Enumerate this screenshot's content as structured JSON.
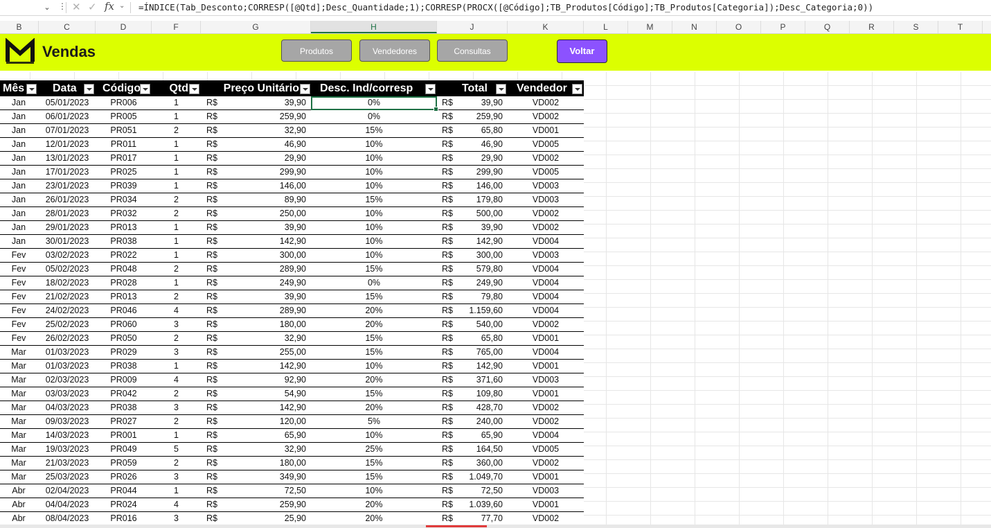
{
  "formula_bar": {
    "formula": "=ÍNDICE(Tab_Desconto;CORRESP([@Qtd];Desc_Quantidade;1);CORRESP(PROCX([@Código];TB_Produtos[Código];TB_Produtos[Categoria]);Desc_Categoria;0))",
    "fx_label": "fx"
  },
  "columns": [
    "B",
    "C",
    "D",
    "F",
    "G",
    "H",
    "J",
    "K",
    "L",
    "M",
    "N",
    "O",
    "P",
    "Q",
    "R",
    "S",
    "T"
  ],
  "banner": {
    "title": "Vendas",
    "buttons": [
      "Produtos",
      "Vendedores",
      "Consultas"
    ],
    "back": "Voltar",
    "colors": {
      "banner_bg": "#dcff00",
      "voltar_bg": "#8c52ff",
      "nav_bg": "#a6a6a6"
    }
  },
  "table": {
    "headers": [
      "Mês",
      "Data",
      "Código",
      "Qtd",
      "Preço Unitário",
      "Desc. Ind/corresp",
      "Total",
      "Vendedor"
    ],
    "currency": "R$",
    "rows": [
      [
        "Jan",
        "05/01/2023",
        "PR006",
        "1",
        "39,90",
        "0%",
        "39,90",
        "VD002"
      ],
      [
        "Jan",
        "06/01/2023",
        "PR005",
        "1",
        "259,90",
        "0%",
        "259,90",
        "VD002"
      ],
      [
        "Jan",
        "07/01/2023",
        "PR051",
        "2",
        "32,90",
        "15%",
        "65,80",
        "VD001"
      ],
      [
        "Jan",
        "12/01/2023",
        "PR011",
        "1",
        "46,90",
        "10%",
        "46,90",
        "VD005"
      ],
      [
        "Jan",
        "13/01/2023",
        "PR017",
        "1",
        "29,90",
        "10%",
        "29,90",
        "VD002"
      ],
      [
        "Jan",
        "17/01/2023",
        "PR025",
        "1",
        "299,90",
        "10%",
        "299,90",
        "VD005"
      ],
      [
        "Jan",
        "23/01/2023",
        "PR039",
        "1",
        "146,00",
        "10%",
        "146,00",
        "VD003"
      ],
      [
        "Jan",
        "26/01/2023",
        "PR034",
        "2",
        "89,90",
        "15%",
        "179,80",
        "VD003"
      ],
      [
        "Jan",
        "28/01/2023",
        "PR032",
        "2",
        "250,00",
        "10%",
        "500,00",
        "VD002"
      ],
      [
        "Jan",
        "29/01/2023",
        "PR013",
        "1",
        "39,90",
        "10%",
        "39,90",
        "VD002"
      ],
      [
        "Jan",
        "30/01/2023",
        "PR038",
        "1",
        "142,90",
        "10%",
        "142,90",
        "VD004"
      ],
      [
        "Fev",
        "03/02/2023",
        "PR022",
        "1",
        "300,00",
        "10%",
        "300,00",
        "VD003"
      ],
      [
        "Fev",
        "05/02/2023",
        "PR048",
        "2",
        "289,90",
        "15%",
        "579,80",
        "VD004"
      ],
      [
        "Fev",
        "18/02/2023",
        "PR028",
        "1",
        "249,90",
        "0%",
        "249,90",
        "VD004"
      ],
      [
        "Fev",
        "21/02/2023",
        "PR013",
        "2",
        "39,90",
        "15%",
        "79,80",
        "VD004"
      ],
      [
        "Fev",
        "24/02/2023",
        "PR046",
        "4",
        "289,90",
        "20%",
        "1.159,60",
        "VD004"
      ],
      [
        "Fev",
        "25/02/2023",
        "PR060",
        "3",
        "180,00",
        "20%",
        "540,00",
        "VD002"
      ],
      [
        "Fev",
        "26/02/2023",
        "PR050",
        "2",
        "32,90",
        "15%",
        "65,80",
        "VD001"
      ],
      [
        "Mar",
        "01/03/2023",
        "PR029",
        "3",
        "255,00",
        "15%",
        "765,00",
        "VD004"
      ],
      [
        "Mar",
        "01/03/2023",
        "PR038",
        "1",
        "142,90",
        "10%",
        "142,90",
        "VD001"
      ],
      [
        "Mar",
        "02/03/2023",
        "PR009",
        "4",
        "92,90",
        "20%",
        "371,60",
        "VD003"
      ],
      [
        "Mar",
        "03/03/2023",
        "PR042",
        "2",
        "54,90",
        "15%",
        "109,80",
        "VD001"
      ],
      [
        "Mar",
        "04/03/2023",
        "PR038",
        "3",
        "142,90",
        "20%",
        "428,70",
        "VD002"
      ],
      [
        "Mar",
        "09/03/2023",
        "PR027",
        "2",
        "120,00",
        "5%",
        "240,00",
        "VD002"
      ],
      [
        "Mar",
        "14/03/2023",
        "PR001",
        "1",
        "65,90",
        "10%",
        "65,90",
        "VD004"
      ],
      [
        "Mar",
        "19/03/2023",
        "PR049",
        "5",
        "32,90",
        "25%",
        "164,50",
        "VD005"
      ],
      [
        "Mar",
        "21/03/2023",
        "PR059",
        "2",
        "180,00",
        "15%",
        "360,00",
        "VD002"
      ],
      [
        "Mar",
        "25/03/2023",
        "PR026",
        "3",
        "349,90",
        "15%",
        "1.049,70",
        "VD001"
      ],
      [
        "Abr",
        "02/04/2023",
        "PR044",
        "1",
        "72,50",
        "10%",
        "72,50",
        "VD003"
      ],
      [
        "Abr",
        "04/04/2023",
        "PR024",
        "4",
        "259,90",
        "20%",
        "1.039,60",
        "VD001"
      ],
      [
        "Abr",
        "08/04/2023",
        "PR016",
        "3",
        "25,90",
        "20%",
        "77,70",
        "VD002"
      ]
    ]
  }
}
